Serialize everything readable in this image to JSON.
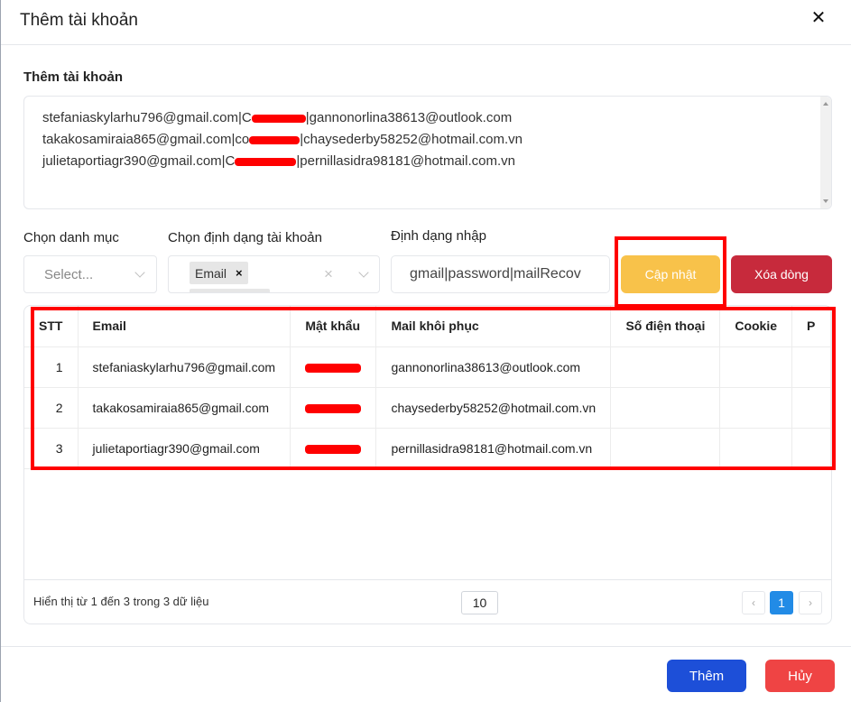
{
  "modal": {
    "title": "Thêm tài khoản",
    "close_icon": "close-icon",
    "section_label": "Thêm tài khoản",
    "textarea": {
      "lines": [
        {
          "email": "stefaniaskylarhu796@gmail.com|C",
          "tail": "|gannonorlina38613@outlook.com"
        },
        {
          "email": "takakosamiraia865@gmail.com|co",
          "tail": "|chaysederby58252@hotmail.com.vn"
        },
        {
          "email": "julietaportiagr390@gmail.com|C",
          "tail": "|pernillasidra98181@hotmail.com.vn"
        }
      ]
    },
    "filters": {
      "category_label": "Chọn danh mục",
      "category_placeholder": "Select...",
      "format_label": "Chọn định dạng tài khoản",
      "format_chips": [
        "Email"
      ],
      "import_label": "Định dạng nhập",
      "import_value": "gmail|password|mailRecov"
    },
    "buttons": {
      "update": "Cập nhật",
      "delete_row": "Xóa dòng",
      "add": "Thêm",
      "cancel": "Hủy"
    },
    "table": {
      "headers": [
        "STT",
        "Email",
        "Mật khẩu",
        "Mail khôi phục",
        "Số điện thoại",
        "Cookie",
        "P"
      ],
      "rows": [
        {
          "stt": "1",
          "email": "stefaniaskylarhu796@gmail.com",
          "password": "[redacted]",
          "recovery": "gannonorlina38613@outlook.com",
          "phone": "",
          "cookie": ""
        },
        {
          "stt": "2",
          "email": "takakosamiraia865@gmail.com",
          "password": "[redacted]",
          "recovery": "chaysederby58252@hotmail.com.vn",
          "phone": "",
          "cookie": ""
        },
        {
          "stt": "3",
          "email": "julietaportiagr390@gmail.com",
          "password": "[redacted]",
          "recovery": "pernillasidra98181@hotmail.com.vn",
          "phone": "",
          "cookie": ""
        }
      ],
      "footer_info": "Hiển thị từ 1 đến 3 trong 3 dữ liệu",
      "page_size": "10",
      "current_page": "1",
      "prev_label": "‹",
      "next_label": "›"
    },
    "colors": {
      "update": "#f8c24a",
      "delete_row": "#c72a3c",
      "add": "#1d4fd8",
      "cancel": "#ef4444",
      "page_active": "#228be6",
      "highlight": "#ff0000"
    }
  }
}
